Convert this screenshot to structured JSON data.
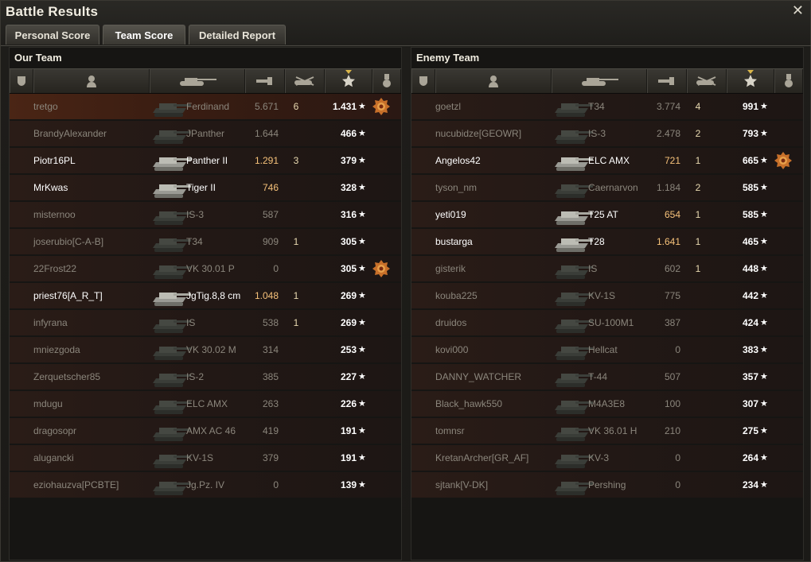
{
  "window": {
    "title": "Battle Results",
    "close": "✕"
  },
  "tabs": [
    {
      "label": "Personal Score",
      "active": false
    },
    {
      "label": "Team Score",
      "active": true
    },
    {
      "label": "Detailed Report",
      "active": false
    }
  ],
  "our_team": {
    "title": "Our Team",
    "players": [
      {
        "name": "tretgo",
        "vehicle": "Ferdinand",
        "damage": "5.671",
        "kills": "6",
        "xp": "1.431",
        "medal": true,
        "alive": false,
        "highlight": true
      },
      {
        "name": "BrandyAlexander",
        "vehicle": "JPanther",
        "damage": "1.644",
        "kills": "",
        "xp": "466",
        "medal": false,
        "alive": false
      },
      {
        "name": "Piotr16PL",
        "vehicle": "Panther II",
        "damage": "1.291",
        "kills": "3",
        "xp": "379",
        "medal": false,
        "alive": true
      },
      {
        "name": "MrKwas",
        "vehicle": "Tiger II",
        "damage": "746",
        "kills": "",
        "xp": "328",
        "medal": false,
        "alive": true
      },
      {
        "name": "misternoo",
        "vehicle": "IS-3",
        "damage": "587",
        "kills": "",
        "xp": "316",
        "medal": false,
        "alive": false
      },
      {
        "name": "joserubio[C-A-B]",
        "vehicle": "T34",
        "damage": "909",
        "kills": "1",
        "xp": "305",
        "medal": false,
        "alive": false
      },
      {
        "name": "22Frost22",
        "vehicle": "VK 30.01 P",
        "damage": "0",
        "kills": "",
        "xp": "305",
        "medal": true,
        "alive": false
      },
      {
        "name": "priest76[A_R_T]",
        "vehicle": "JgTig.8,8 cm",
        "damage": "1.048",
        "kills": "1",
        "xp": "269",
        "medal": false,
        "alive": true
      },
      {
        "name": "infyrana",
        "vehicle": "IS",
        "damage": "538",
        "kills": "1",
        "xp": "269",
        "medal": false,
        "alive": false
      },
      {
        "name": "mniezgoda",
        "vehicle": "VK 30.02 M",
        "damage": "314",
        "kills": "",
        "xp": "253",
        "medal": false,
        "alive": false
      },
      {
        "name": "Zerquetscher85",
        "vehicle": "IS-2",
        "damage": "385",
        "kills": "",
        "xp": "227",
        "medal": false,
        "alive": false
      },
      {
        "name": "mdugu",
        "vehicle": "ELC AMX",
        "damage": "263",
        "kills": "",
        "xp": "226",
        "medal": false,
        "alive": false
      },
      {
        "name": "dragosopr",
        "vehicle": "AMX AC 46",
        "damage": "419",
        "kills": "",
        "xp": "191",
        "medal": false,
        "alive": false
      },
      {
        "name": "alugancki",
        "vehicle": "KV-1S",
        "damage": "379",
        "kills": "",
        "xp": "191",
        "medal": false,
        "alive": false
      },
      {
        "name": "eziohauzva[PCBTE]",
        "vehicle": "Jg.Pz. IV",
        "damage": "0",
        "kills": "",
        "xp": "139",
        "medal": false,
        "alive": false
      }
    ]
  },
  "enemy_team": {
    "title": "Enemy Team",
    "players": [
      {
        "name": "goetzl",
        "vehicle": "T34",
        "damage": "3.774",
        "kills": "4",
        "xp": "991",
        "medal": false,
        "alive": false
      },
      {
        "name": "nucubidze[GEOWR]",
        "vehicle": "IS-3",
        "damage": "2.478",
        "kills": "2",
        "xp": "793",
        "medal": false,
        "alive": false
      },
      {
        "name": "Angelos42",
        "vehicle": "ELC AMX",
        "damage": "721",
        "kills": "1",
        "xp": "665",
        "medal": true,
        "alive": true
      },
      {
        "name": "tyson_nm",
        "vehicle": "Caernarvon",
        "damage": "1.184",
        "kills": "2",
        "xp": "585",
        "medal": false,
        "alive": false
      },
      {
        "name": "yeti019",
        "vehicle": "T25 AT",
        "damage": "654",
        "kills": "1",
        "xp": "585",
        "medal": false,
        "alive": true
      },
      {
        "name": "bustarga",
        "vehicle": "T28",
        "damage": "1.641",
        "kills": "1",
        "xp": "465",
        "medal": false,
        "alive": true
      },
      {
        "name": "gisterik",
        "vehicle": "IS",
        "damage": "602",
        "kills": "1",
        "xp": "448",
        "medal": false,
        "alive": false
      },
      {
        "name": "kouba225",
        "vehicle": "KV-1S",
        "damage": "775",
        "kills": "",
        "xp": "442",
        "medal": false,
        "alive": false
      },
      {
        "name": "druidos",
        "vehicle": "SU-100M1",
        "damage": "387",
        "kills": "",
        "xp": "424",
        "medal": false,
        "alive": false
      },
      {
        "name": "kovi000",
        "vehicle": "Hellcat",
        "damage": "0",
        "kills": "",
        "xp": "383",
        "medal": false,
        "alive": false
      },
      {
        "name": "DANNY_WATCHER",
        "vehicle": "T-44",
        "damage": "507",
        "kills": "",
        "xp": "357",
        "medal": false,
        "alive": false
      },
      {
        "name": "Black_hawk550",
        "vehicle": "M4A3E8",
        "damage": "100",
        "kills": "",
        "xp": "307",
        "medal": false,
        "alive": false
      },
      {
        "name": "tomnsr",
        "vehicle": "VK 36.01 H",
        "damage": "210",
        "kills": "",
        "xp": "275",
        "medal": false,
        "alive": false
      },
      {
        "name": "KretanArcher[GR_AF]",
        "vehicle": "KV-3",
        "damage": "0",
        "kills": "",
        "xp": "264",
        "medal": false,
        "alive": false
      },
      {
        "name": "sjtank[V-DK]",
        "vehicle": "Pershing",
        "damage": "0",
        "kills": "",
        "xp": "234",
        "medal": false,
        "alive": false
      }
    ]
  },
  "columns": [
    "squad-icon",
    "player-icon",
    "vehicle-icon",
    "damage-icon",
    "kills-icon",
    "xp-star-icon",
    "medal-icon"
  ],
  "colors": {
    "alive": "#ffffff",
    "dead": "#8b867c",
    "damage_alive": "#f6c27a",
    "sort_accent": "#d9b64a"
  },
  "star_glyph": "★"
}
